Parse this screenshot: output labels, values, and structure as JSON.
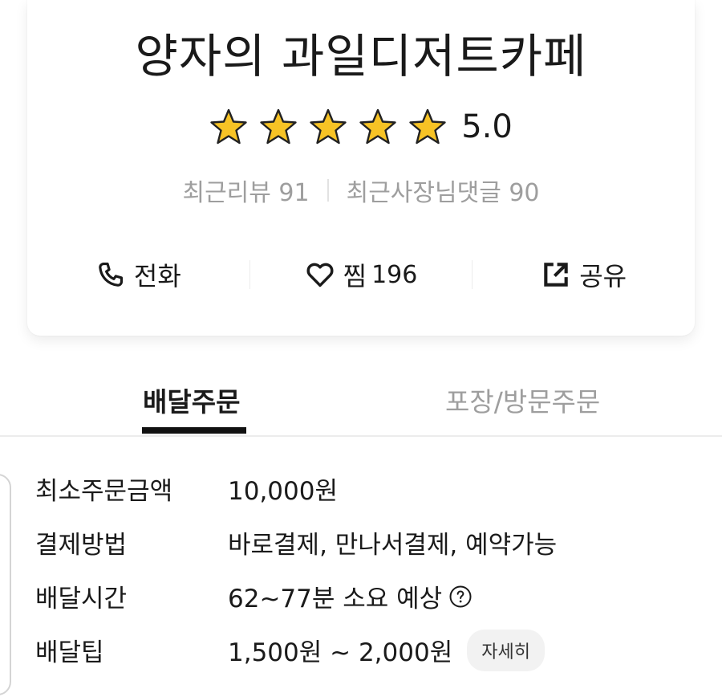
{
  "store": {
    "name": "양자의 과일디저트카페",
    "rating": {
      "value": "5.0",
      "stars": 5,
      "max_stars": 5
    },
    "reviews": {
      "recent_review_label": "최근리뷰 91",
      "recent_reply_label": "최근사장님댓글 90"
    }
  },
  "actions": {
    "call_label": "전화",
    "like_label": "찜",
    "like_count": "196",
    "share_label": "공유"
  },
  "tabs": [
    {
      "label": "배달주문",
      "active": true
    },
    {
      "label": "포장/방문주문",
      "active": false
    }
  ],
  "info": [
    {
      "label": "최소주문금액",
      "value": "10,000원"
    },
    {
      "label": "결제방법",
      "value": "바로결제, 만나서결제, 예약가능"
    },
    {
      "label": "배달시간",
      "value": "62~77분 소요 예상"
    },
    {
      "label": "배달팁",
      "value": "1,500원 ~ 2,000원",
      "chip": "자세히"
    }
  ],
  "colors": {
    "star": "#f7c325",
    "muted_text": "#9e9e9e",
    "tab_underline": "#111111"
  },
  "icons": [
    "phone-icon",
    "heart-icon",
    "share-icon",
    "help-icon",
    "star-icon"
  ]
}
